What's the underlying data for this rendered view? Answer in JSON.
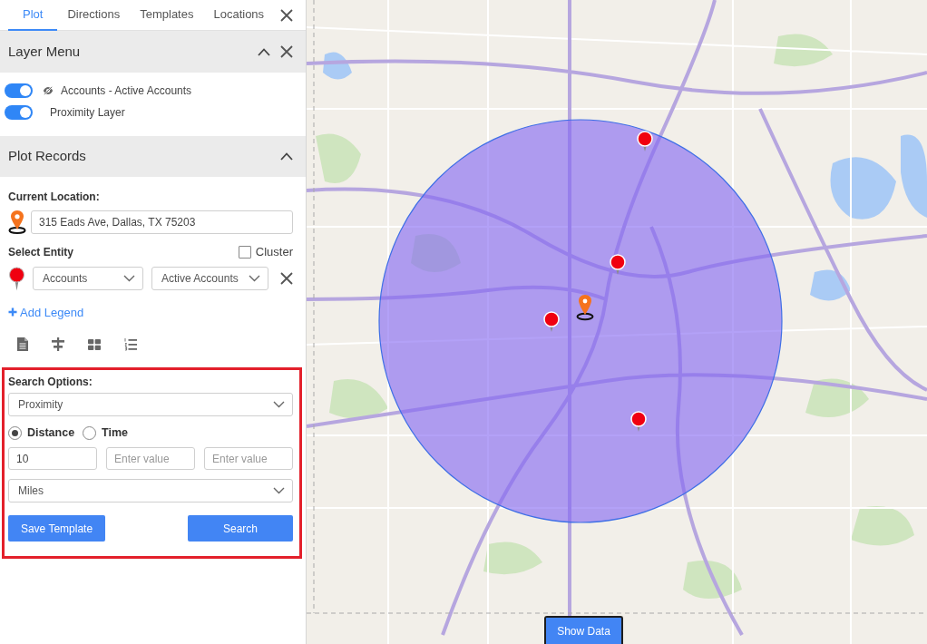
{
  "tabs": [
    {
      "label": "Plot",
      "selected": true
    },
    {
      "label": "Directions",
      "selected": false
    },
    {
      "label": "Templates",
      "selected": false
    },
    {
      "label": "Locations",
      "selected": false
    }
  ],
  "layer_menu": {
    "title": "Layer Menu",
    "expanded": true,
    "layers": [
      {
        "label": "Accounts - Active Accounts",
        "on": true,
        "kind": "entity"
      },
      {
        "label": "Proximity Layer",
        "on": true,
        "kind": "overlay"
      }
    ]
  },
  "plot_records": {
    "title": "Plot Records",
    "expanded": true,
    "current_location": {
      "label": "Current Location:",
      "value": "315 Eads Ave, Dallas, TX 75203"
    },
    "select_entity": {
      "label": "Select Entity",
      "cluster": {
        "label": "Cluster",
        "checked": false
      },
      "entity": "Accounts",
      "filter": "Active Accounts"
    },
    "add_legend": "Add Legend"
  },
  "search_options": {
    "highlighted": true,
    "label": "Search Options:",
    "type": "Proximity",
    "modes": [
      {
        "label": "Distance",
        "selected": true
      },
      {
        "label": "Time",
        "selected": false
      }
    ],
    "inputs": [
      {
        "value": "10"
      },
      {
        "placeholder": "Enter value"
      },
      {
        "placeholder": "Enter value"
      }
    ],
    "unit": "Miles",
    "buttons": [
      "Save Template",
      "Search"
    ]
  },
  "map": {
    "show_data": "Show Data"
  }
}
